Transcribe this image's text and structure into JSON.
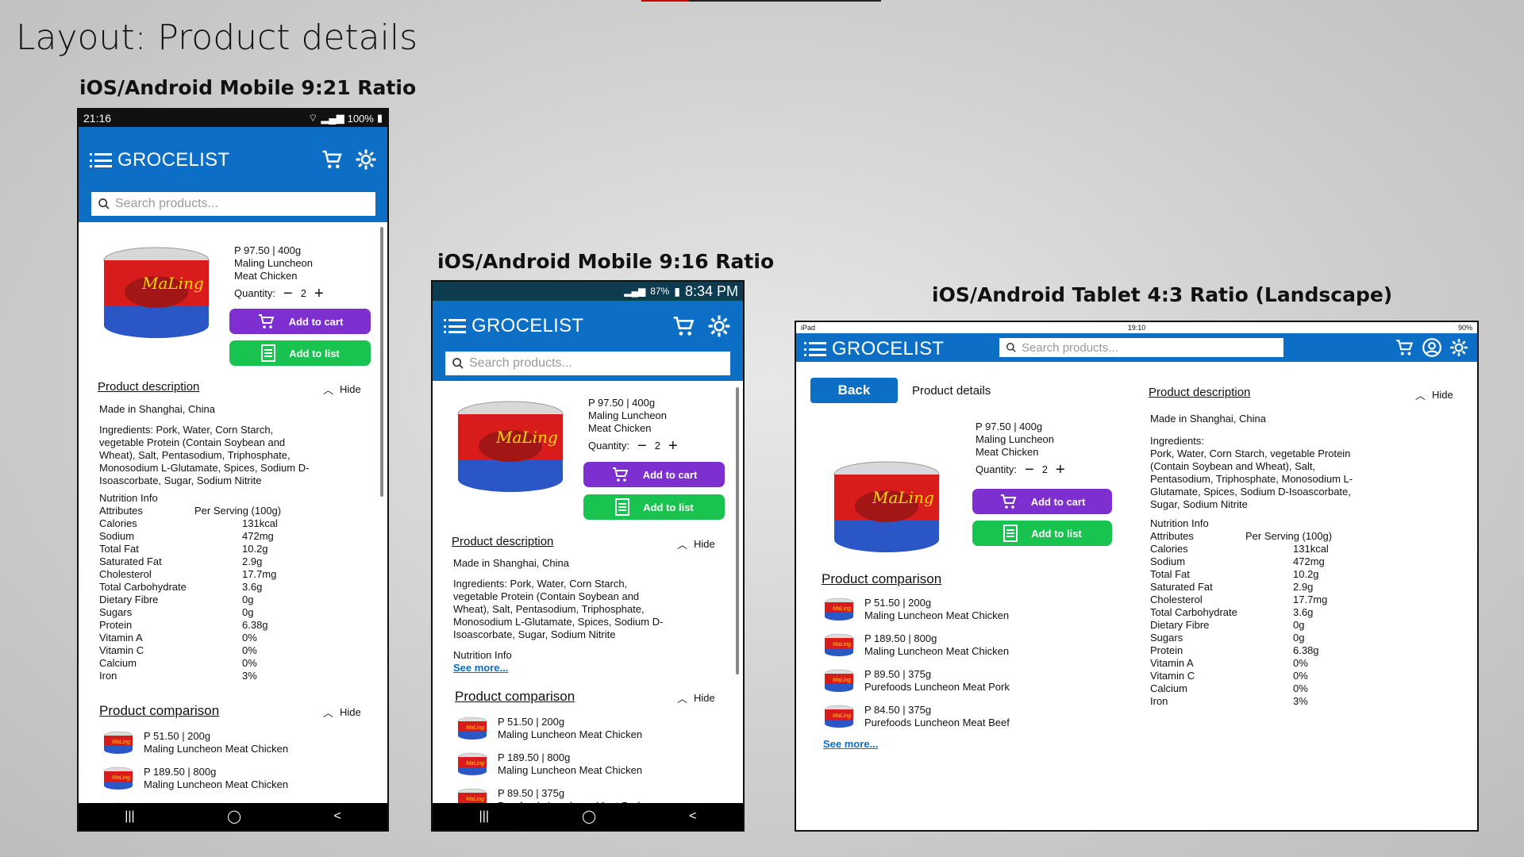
{
  "slide": {
    "title": "Layout: Product details"
  },
  "devices": {
    "mobile921": {
      "label": "iOS/Android Mobile 9:21 Ratio",
      "time": "21:16",
      "status_right": "100%"
    },
    "mobile916": {
      "label": "iOS/Android Mobile 9:16 Ratio",
      "battery": "87%",
      "time": "8:34 PM"
    },
    "tablet": {
      "label": "iOS/Android Tablet 4:3 Ratio (Landscape)",
      "carrier": "iPad",
      "time": "19:10",
      "battery": "90%"
    }
  },
  "app": {
    "brand": "GROCELIST",
    "search_placeholder": "Search products...",
    "back": "Back",
    "page_title": "Product details"
  },
  "product": {
    "price": "P 97.50 | 400g",
    "name_line1": "Maling Luncheon",
    "name_line2": "Meat Chicken",
    "quantity_label": "Quantity:",
    "quantity": "2",
    "minus": "−",
    "plus": "+",
    "add_to_cart": "Add to cart",
    "add_to_list": "Add to list"
  },
  "description": {
    "title": "Product description",
    "hide": "Hide",
    "origin": "Made in Shanghai, China",
    "ingredients_label": "Ingredients:",
    "ingredients": "Pork, Water, Corn Starch, vegetable Protein (Contain Soybean and Wheat), Salt, Pentasodium, Triphosphate, Monosodium L-Glutamate, Spices, Sodium D-Isoascorbate, Sugar, Sodium Nitrite",
    "m_lines": [
      "Ingredients: Pork, Water, Corn Starch,",
      "vegetable Protein (Contain Soybean and",
      "Wheat), Salt, Pentasodium, Triphosphate,",
      "Monosodium L-Glutamate, Spices, Sodium D-",
      "Isoascorbate, Sugar, Sodium Nitrite"
    ],
    "t_lines": [
      "Pork, Water, Corn Starch, vegetable Protein",
      "(Contain Soybean and Wheat), Salt,",
      "Pentasodium, Triphosphate, Monosodium L-",
      "Glutamate, Spices, Sodium D-Isoascorbate,",
      "Sugar, Sodium Nitrite"
    ],
    "nutrition_title": "Nutrition Info",
    "see_more": "See more...",
    "nutrition_header": [
      "Attributes",
      "Per Serving (100g)"
    ],
    "nutrition": [
      [
        "Calories",
        "131kcal"
      ],
      [
        "Sodium",
        "472mg"
      ],
      [
        "Total Fat",
        "10.2g"
      ],
      [
        "Saturated Fat",
        "2.9g"
      ],
      [
        "Cholesterol",
        "17.7mg"
      ],
      [
        "Total Carbohydrate",
        "3.6g"
      ],
      [
        "Dietary Fibre",
        "0g"
      ],
      [
        "Sugars",
        "0g"
      ],
      [
        "Protein",
        "6.38g"
      ],
      [
        "Vitamin A",
        "0%"
      ],
      [
        "Vitamin C",
        "0%"
      ],
      [
        "Calcium",
        "0%"
      ],
      [
        "Iron",
        "3%"
      ]
    ]
  },
  "comparison": {
    "title": "Product comparison",
    "hide": "Hide",
    "see_more": "See more...",
    "items": [
      {
        "price": "P 51.50 | 200g",
        "name": "Maling Luncheon Meat Chicken"
      },
      {
        "price": "P 189.50 | 800g",
        "name": "Maling Luncheon Meat Chicken"
      },
      {
        "price": "P 89.50 | 375g",
        "name": "Purefoods Luncheon Meat Pork"
      },
      {
        "price": "P 84.50 | 375g",
        "name": "Purefoods Luncheon Meat Beef"
      }
    ]
  }
}
